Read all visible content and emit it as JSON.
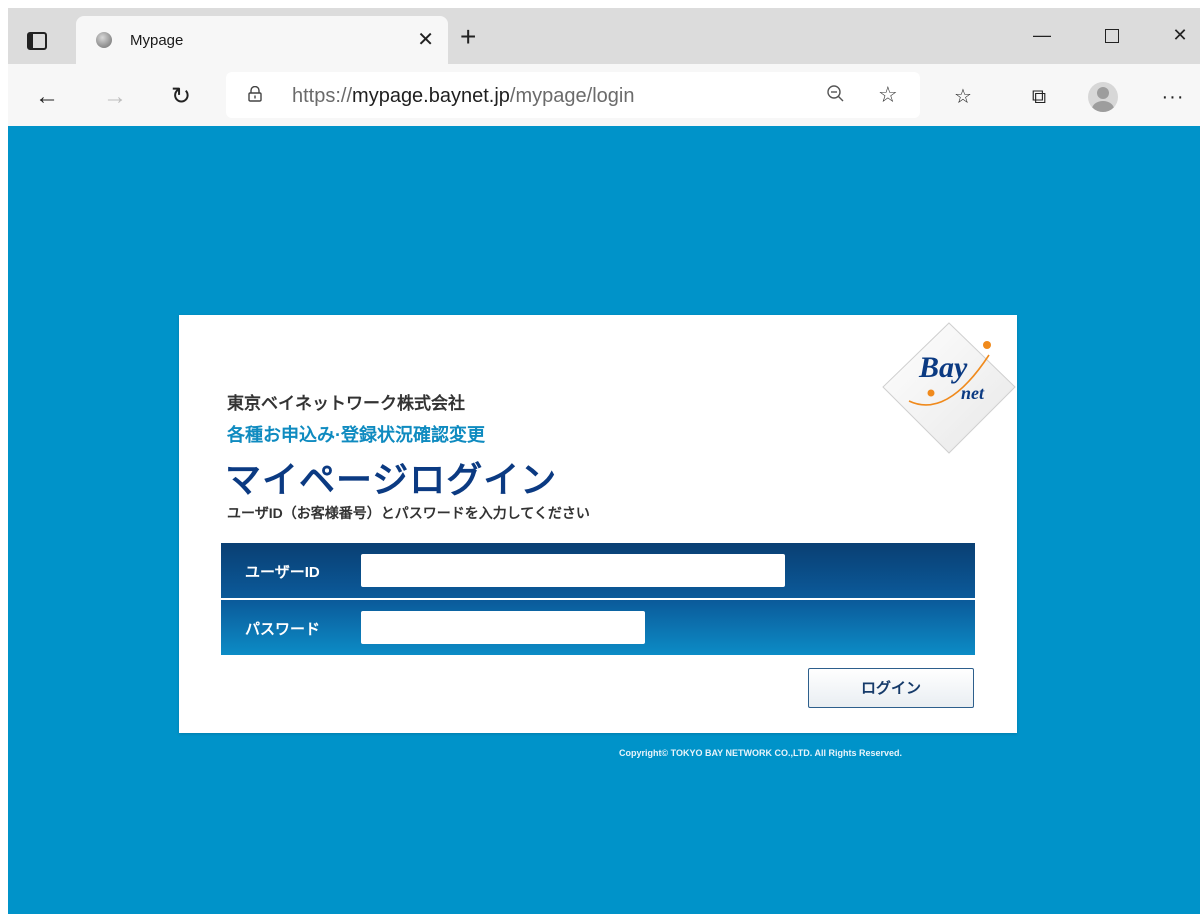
{
  "browser": {
    "tab_title": "Mypage",
    "new_tab_label": "+",
    "url": {
      "scheme": "https://",
      "host": "mypage.baynet.jp",
      "path": "/mypage/login"
    }
  },
  "page": {
    "logo_text": "Bay",
    "logo_subtext": "net",
    "company": "東京ベイネットワーク株式会社",
    "subtitle": "各種お申込み·登録状況確認変更",
    "heading": "マイページログイン",
    "instruction": "ユーザID（お客様番号）とパスワードを入力してください",
    "form": {
      "user_id_label": "ユーザーID",
      "user_id_value": "",
      "password_label": "パスワード",
      "password_value": ""
    },
    "login_button": "ログイン",
    "copyright": "Copyright© TOKYO BAY NETWORK CO.,LTD. All Rights Reserved."
  },
  "colors": {
    "page_background": "#0093c9",
    "heading": "#0b3a82",
    "subtitle": "#0f8bc0",
    "form_dark": "#0a3f73",
    "form_light": "#0c8cc6",
    "logo_orange": "#f08a1c"
  },
  "icons": {
    "tab_actions": "tab-actions-icon",
    "favicon": "globe-favicon-icon",
    "close": "close-icon",
    "back": "back-arrow-icon",
    "forward": "forward-arrow-icon",
    "reload": "reload-icon",
    "lock": "lock-icon",
    "zoom": "zoom-out-icon",
    "favorite_add": "add-favorite-icon",
    "favorites": "favorites-icon",
    "collections": "collections-icon",
    "profile": "profile-avatar-icon",
    "more": "more-icon"
  }
}
